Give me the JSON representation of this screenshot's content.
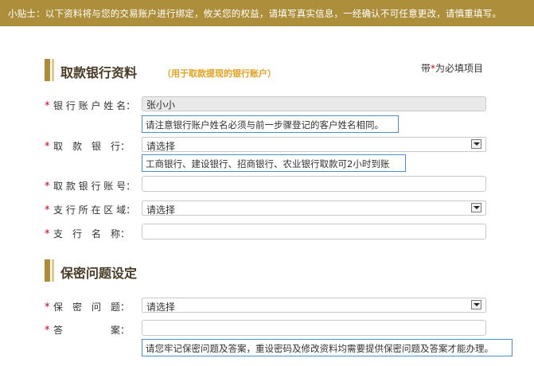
{
  "tip": "小贴士：以下资料将与您的交易账户进行绑定，攸关您的权益，请填写真实信息，一经确认不可任意更改，请慎重填写。",
  "required_note": {
    "prefix": "带",
    "star": "*",
    "suffix": "为必填项目"
  },
  "sections": {
    "bank": {
      "title": "取款银行资料",
      "subtitle": "（用于取款提现的银行账户）"
    },
    "security": {
      "title": "保密问题设定"
    }
  },
  "fields": {
    "account_name": {
      "star": "*",
      "label": "银 行 账 户 姓 名：",
      "value": "张小小",
      "hint": "请注意银行账户姓名必须与前一步骤登记的客户姓名相同。"
    },
    "bank": {
      "star": "*",
      "label": "取　款　银　行：",
      "value": "请选择",
      "hint": "工商银行、建设银行、招商银行、农业银行取款可2小时到账"
    },
    "account_no": {
      "star": "*",
      "label": "取 款 银 行 账 号：",
      "value": ""
    },
    "region": {
      "star": "*",
      "label": "支 行 所 在 区 域：",
      "value": "请选择"
    },
    "branch": {
      "star": "*",
      "label": "支　行　名　称：",
      "value": ""
    },
    "question": {
      "star": "*",
      "label": "保　密　问　题：",
      "value": "请选择"
    },
    "answer": {
      "star": "*",
      "label": "答　　　　　案：",
      "value": "",
      "hint": "请您牢记保密问题及答案，重设密码及修改资料均需要提供保密问题及答案才能办理。"
    }
  },
  "colors": {
    "tip_bar": "#ad8f3b",
    "accent": "#b08b36",
    "subtitle": "#e3a11e",
    "star": "#d0021b",
    "hint_border": "#4a90c8"
  }
}
